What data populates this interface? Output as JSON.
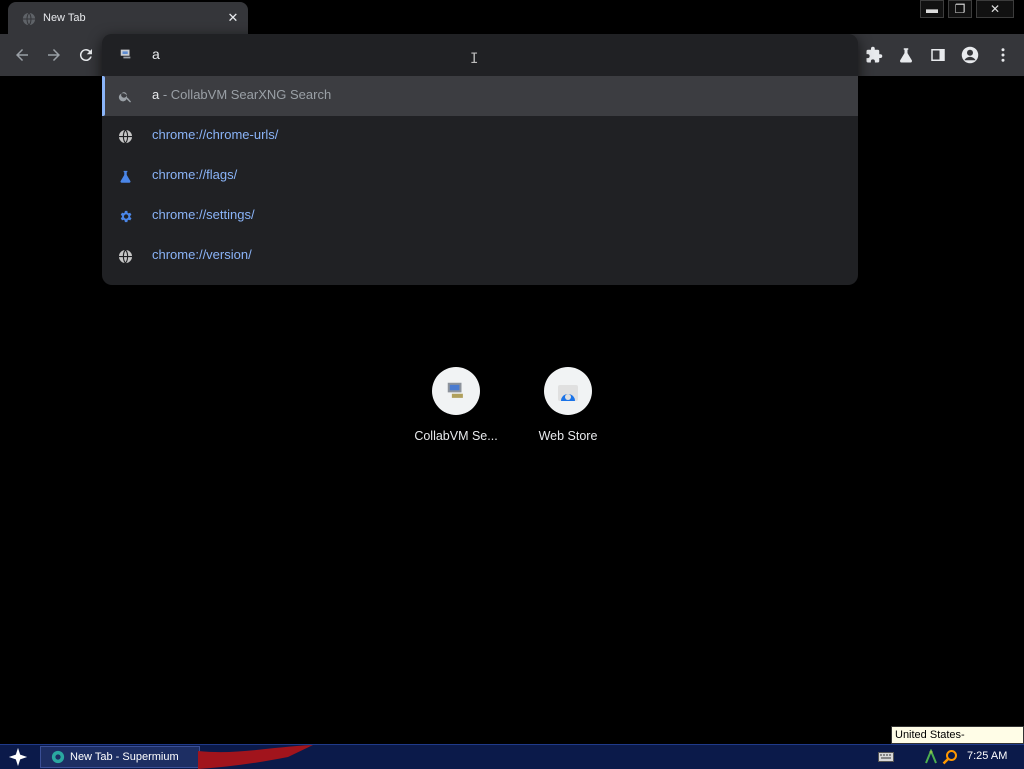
{
  "tab": {
    "title": "New Tab",
    "close_glyph": "✕"
  },
  "window_controls": {
    "minimize": "▬",
    "restore": "❐",
    "close": "✕"
  },
  "omnibox": {
    "input_value": "a",
    "cursor_glyph": "I",
    "suggestions": [
      {
        "query": "a",
        "separator": " - ",
        "description": "CollabVM SearXNG Search",
        "icon": "search-icon",
        "selected": true
      },
      {
        "url": "chrome://chrome-urls/",
        "icon": "globe-icon"
      },
      {
        "url": "chrome://flags/",
        "icon": "flask-icon"
      },
      {
        "url": "chrome://settings/",
        "icon": "gear-icon"
      },
      {
        "url": "chrome://version/",
        "icon": "globe-icon"
      }
    ]
  },
  "shortcuts": [
    {
      "label": "CollabVM Se...",
      "icon": "collabvm-icon"
    },
    {
      "label": "Web Store",
      "icon": "web-store-icon"
    }
  ],
  "taskbar": {
    "task_label": "New Tab - Supermium",
    "clock": "7:25 AM",
    "language_tooltip": "United States-International"
  },
  "colors": {
    "accent": "#8ab4f8",
    "toolbar": "#35363a",
    "dropdown": "#202124",
    "taskbar": "#0b1a4a"
  }
}
